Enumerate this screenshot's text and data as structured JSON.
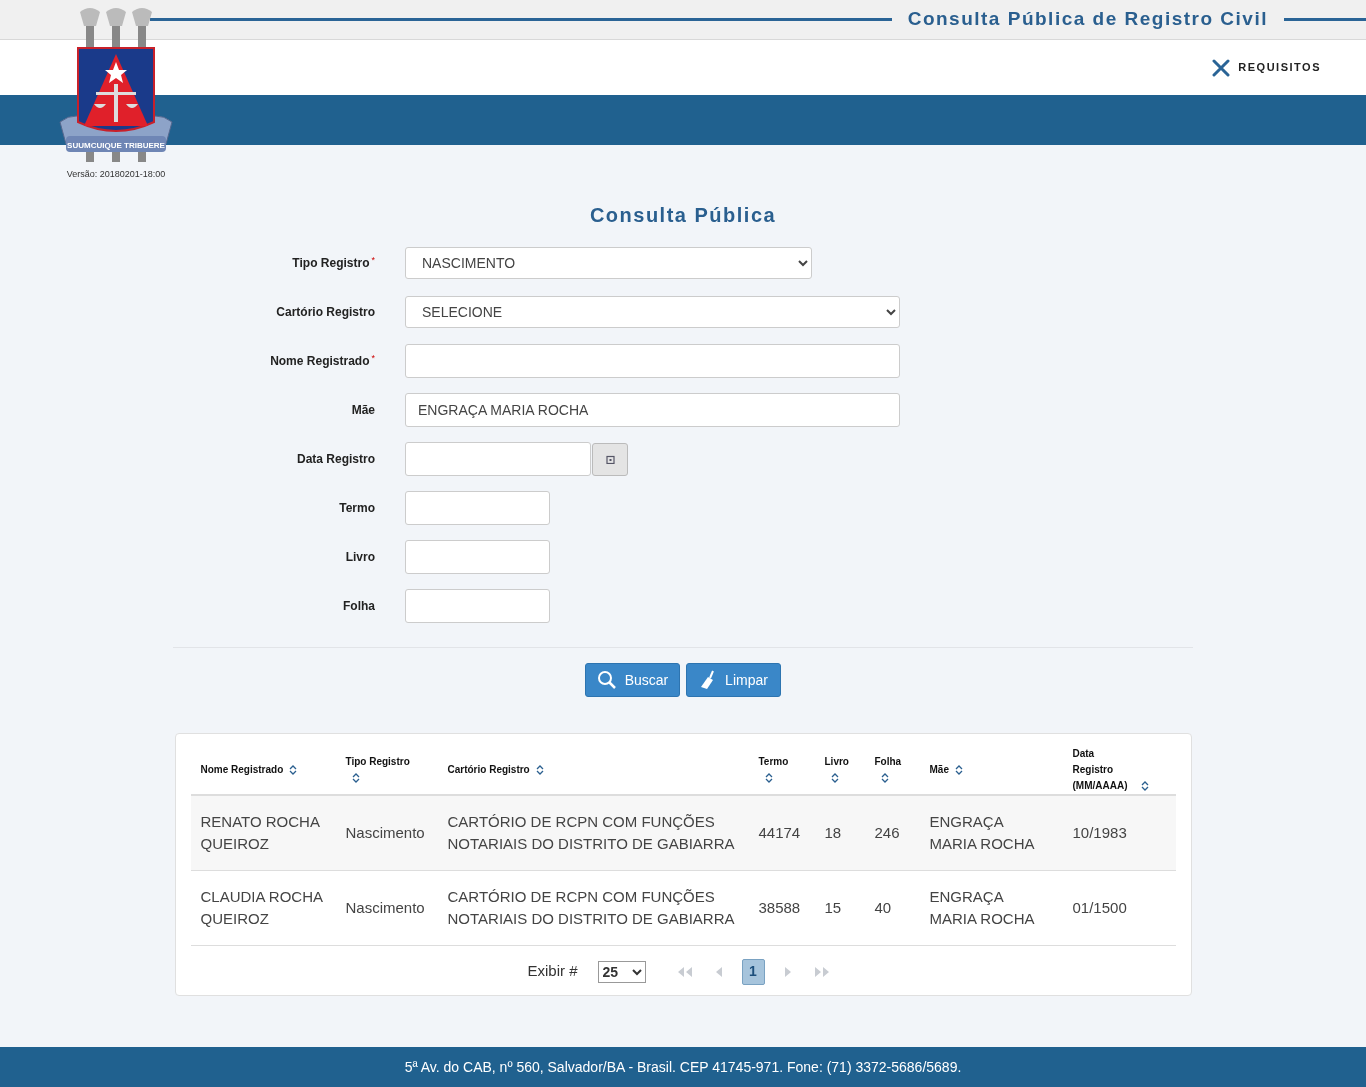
{
  "header": {
    "title": "Consulta Pública de Registro Civil",
    "version": "Versão: 20180201-18:00",
    "motto": "SUUMCUIQUE TRIBUERE",
    "link": "REQUISITOS"
  },
  "form": {
    "title": "Consulta Pública",
    "required_mark": "*",
    "fields": [
      {
        "label": "Tipo Registro",
        "required": true,
        "kind": "select",
        "value": "NASCIMENTO"
      },
      {
        "label": "Cartório Registro",
        "required": false,
        "kind": "select",
        "value": "SELECIONE"
      },
      {
        "label": "Nome Registrado",
        "required": true,
        "kind": "text"
      },
      {
        "label": "Mãe",
        "required": false,
        "kind": "text",
        "value": "ENGRAÇA MARIA ROCHA"
      },
      {
        "label": "Data Registro",
        "required": false,
        "kind": "date"
      },
      {
        "label": "Termo",
        "required": false,
        "kind": "text"
      },
      {
        "label": "Livro",
        "required": false,
        "kind": "text"
      },
      {
        "label": "Folha",
        "required": false,
        "kind": "text"
      }
    ],
    "buttons": [
      {
        "label": "Buscar",
        "kind": "search"
      },
      {
        "label": "Limpar",
        "kind": "clear"
      }
    ]
  },
  "table": {
    "columns": [
      "Nome Registrado",
      "Tipo Registro",
      "Cartório Registro",
      "Termo",
      "Livro",
      "Folha",
      "Mãe",
      "Data Registro (MM/AAAA)"
    ],
    "rows": [
      [
        "RENATO ROCHA QUEIROZ",
        "Nascimento",
        "CARTÓRIO DE RCPN COM FUNÇÕES NOTARIAIS DO DISTRITO DE GABIARRA",
        "44174",
        "18",
        "246",
        "ENGRAÇA MARIA ROCHA",
        "10/1983"
      ],
      [
        "CLAUDIA ROCHA QUEIROZ",
        "Nascimento",
        "CARTÓRIO DE RCPN COM FUNÇÕES NOTARIAIS DO DISTRITO DE GABIARRA",
        "38588",
        "15",
        "40",
        "ENGRAÇA MARIA ROCHA",
        "01/1500"
      ]
    ]
  },
  "pagination": {
    "label": "Exibir #",
    "page_size": "25",
    "pages": [
      {
        "label": "1",
        "selected": true
      }
    ]
  },
  "footer": "5ª Av. do CAB, nº 560, Salvador/BA - Brasil. CEP 41745-971. Fone: (71) 3372-5686/5689."
}
